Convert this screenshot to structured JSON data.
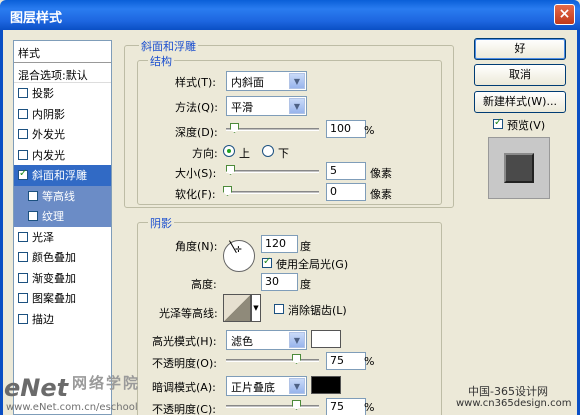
{
  "window": {
    "title": "图层样式",
    "close": "×"
  },
  "styles_list": {
    "header": "样式",
    "blend_options": "混合选项:默认",
    "items": [
      {
        "label": "投影",
        "checked": false
      },
      {
        "label": "内阴影",
        "checked": false
      },
      {
        "label": "外发光",
        "checked": false
      },
      {
        "label": "内发光",
        "checked": false
      },
      {
        "label": "斜面和浮雕",
        "checked": true,
        "selected": true
      },
      {
        "label": "等高线",
        "checked": false,
        "sub": true
      },
      {
        "label": "纹理",
        "checked": false,
        "sub": true
      },
      {
        "label": "光泽",
        "checked": false
      },
      {
        "label": "颜色叠加",
        "checked": false
      },
      {
        "label": "渐变叠加",
        "checked": false
      },
      {
        "label": "图案叠加",
        "checked": false
      },
      {
        "label": "描边",
        "checked": false
      }
    ]
  },
  "bevel": {
    "section_title": "斜面和浮雕",
    "structure": {
      "title": "结构",
      "style_label": "样式(T):",
      "style_value": "内斜面",
      "technique_label": "方法(Q):",
      "technique_value": "平滑",
      "depth_label": "深度(D):",
      "depth_value": "100",
      "percent": "%",
      "direction_label": "方向:",
      "dir_up": "上",
      "dir_down": "下",
      "size_label": "大小(S):",
      "size_value": "5",
      "pixels": "像素",
      "soften_label": "软化(F):",
      "soften_value": "0"
    },
    "shading": {
      "title": "阴影",
      "angle_label": "角度(N):",
      "angle_value": "120",
      "degree": "度",
      "global_light": "使用全局光(G)",
      "altitude_label": "高度:",
      "altitude_value": "30",
      "gloss_label": "光泽等高线:",
      "antialias": "消除锯齿(L)",
      "highlight_mode_label": "高光模式(H):",
      "highlight_mode_value": "滤色",
      "opacity_label": "不透明度(O):",
      "opacity_value": "75",
      "shadow_mode_label": "暗调模式(A):",
      "shadow_mode_value": "正片叠底",
      "opacity2_label": "不透明度(C):",
      "opacity2_value": "75"
    }
  },
  "buttons": {
    "ok": "好",
    "cancel": "取消",
    "new_style": "新建样式(W)...",
    "preview": "预览(V)"
  },
  "watermarks": {
    "left": "eNet",
    "left_cn": "网络学院",
    "left_url": "www.eNet.com.cn/eschool",
    "right": "中国-365设计网",
    "right_url": "www.cn365design.com"
  },
  "colors": {
    "highlight": "#ffffff",
    "shadow": "#000000",
    "accent": "#316ac5"
  }
}
